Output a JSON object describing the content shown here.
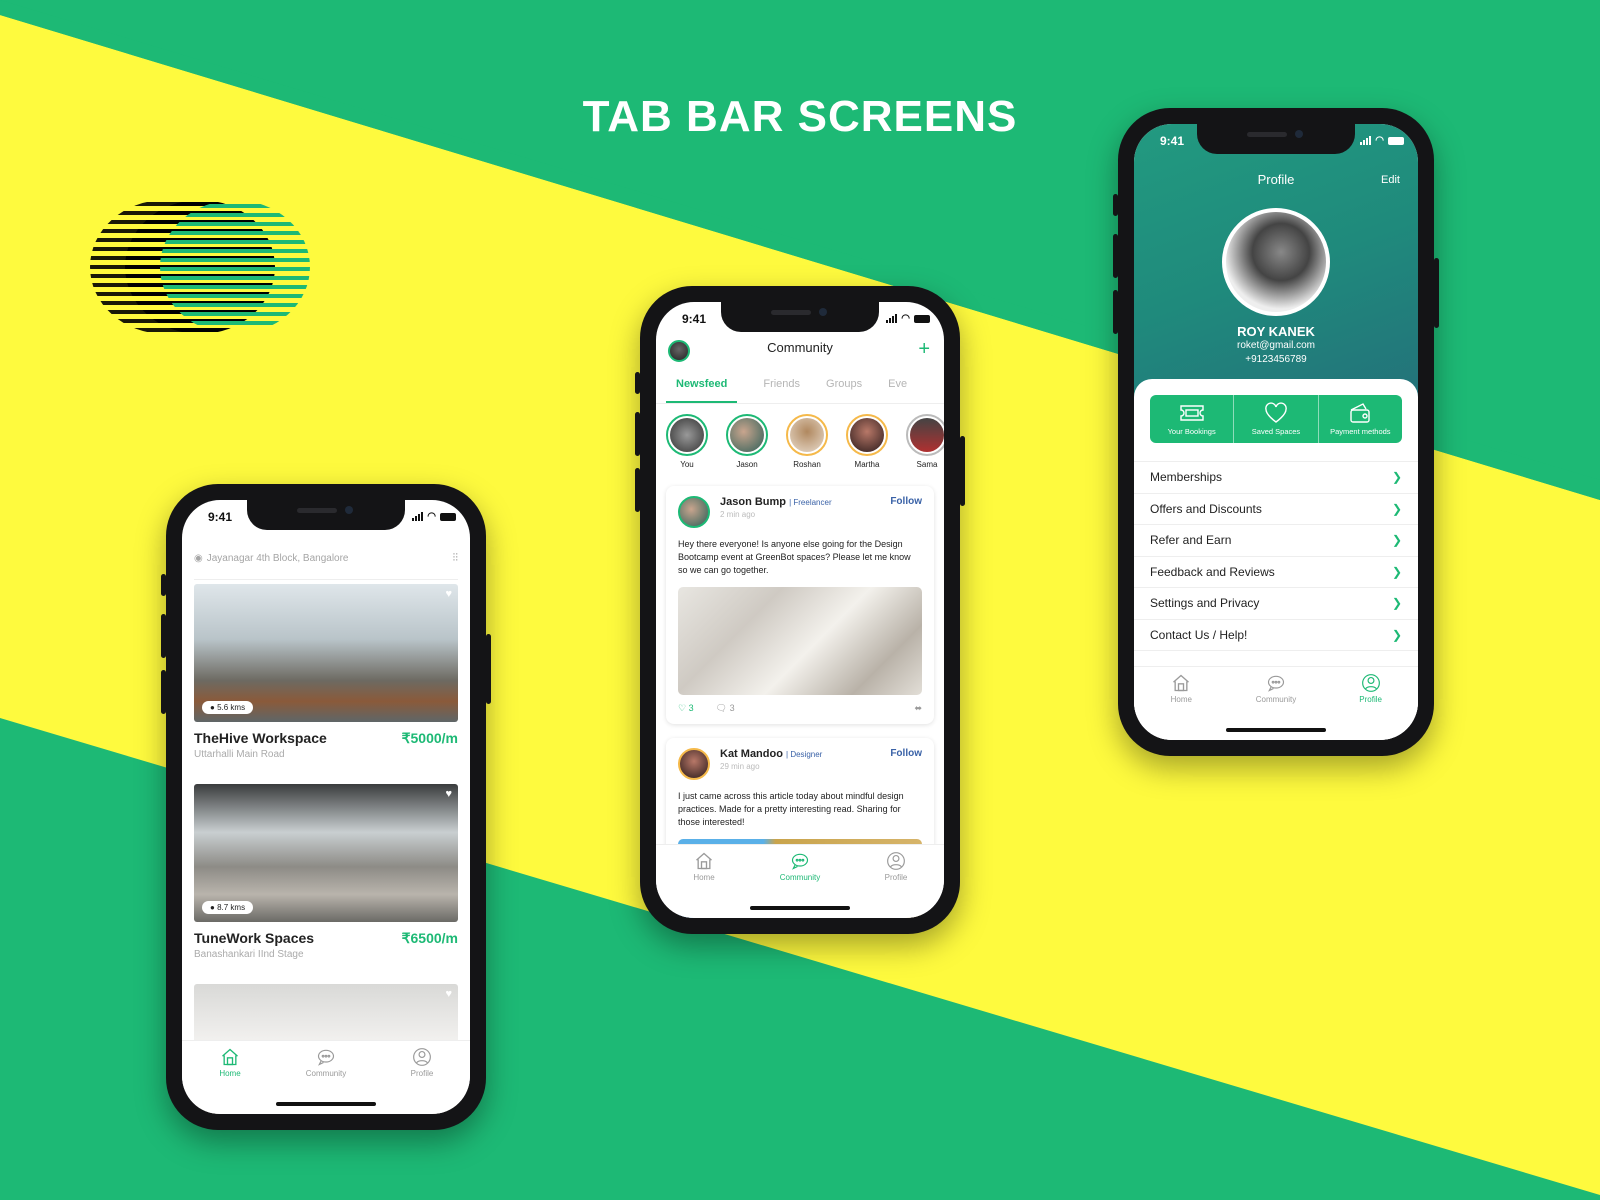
{
  "page": {
    "title": "TAB BAR SCREENS"
  },
  "colors": {
    "accent": "#1db975",
    "yellow": "#fefa3e",
    "navy_link": "#3a62a7",
    "profile_header": "#1f8a7c"
  },
  "status_bar": {
    "time": "9:41"
  },
  "tabbar": {
    "items": [
      {
        "label": "Home",
        "icon": "home-icon"
      },
      {
        "label": "Community",
        "icon": "chat-bubble-icon"
      },
      {
        "label": "Profile",
        "icon": "user-circle-icon"
      }
    ]
  },
  "home_screen": {
    "location": "Jayanagar 4th Block, Bangalore",
    "active_tab": "Home",
    "listings": [
      {
        "name": "TheHive Workspace",
        "address": "Uttarhalli Main Road",
        "price": "₹5000/m",
        "distance": "5.6 kms"
      },
      {
        "name": "TuneWork Spaces",
        "address": "Banashankari IInd Stage",
        "price": "₹6500/m",
        "distance": "8.7 kms"
      },
      {
        "name": "",
        "address": "",
        "price": "",
        "distance": ""
      }
    ]
  },
  "community_screen": {
    "title": "Community",
    "active_tab": "Community",
    "tabs": [
      "Newsfeed",
      "Friends",
      "Groups",
      "Eve"
    ],
    "stories": [
      "You",
      "Jason",
      "Roshan",
      "Martha",
      "Sama"
    ],
    "posts": [
      {
        "author": "Jason Bump",
        "role": "| Freelancer",
        "time": "2 min ago",
        "follow": "Follow",
        "text": "Hey there everyone! Is anyone else going for the Design Bootcamp event at GreenBot spaces? Please let me know so we can go together.",
        "likes": "3",
        "comments": "3"
      },
      {
        "author": "Kat Mandoo",
        "role": "| Designer",
        "time": "29 min ago",
        "follow": "Follow",
        "text": "I just came across this article today about mindful design practices. Made for a pretty interesting read. Sharing for those interested!"
      }
    ]
  },
  "profile_screen": {
    "title": "Profile",
    "edit": "Edit",
    "name": "ROY KANEK",
    "email": "roket@gmail.com",
    "phone": "+9123456789",
    "active_tab": "Profile",
    "quick_actions": [
      {
        "label": "Your Bookings",
        "icon": "ticket-icon"
      },
      {
        "label": "Saved Spaces",
        "icon": "heart-icon"
      },
      {
        "label": "Payment methods",
        "icon": "wallet-icon"
      }
    ],
    "menu": [
      "Memberships",
      "Offers and Discounts",
      "Refer and Earn",
      "Feedback and Reviews",
      "Settings and Privacy",
      "Contact Us / Help!"
    ]
  }
}
